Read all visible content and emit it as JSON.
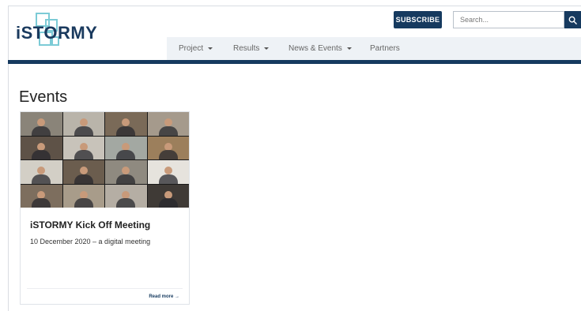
{
  "brand": {
    "name": "iSTORMY"
  },
  "header": {
    "subscribe_label": "SUBSCRIBE",
    "search_placeholder": "Search...",
    "search_value": ""
  },
  "nav": {
    "items": [
      {
        "label": "Project",
        "has_dropdown": true
      },
      {
        "label": "Results",
        "has_dropdown": true
      },
      {
        "label": "News & Events",
        "has_dropdown": true
      },
      {
        "label": "Partners",
        "has_dropdown": false
      }
    ]
  },
  "page": {
    "heading": "Events"
  },
  "events": [
    {
      "title": "iSTORMY Kick Off Meeting",
      "subtitle": "10 December 2020 – a digital meeting",
      "read_more": "Read more →"
    }
  ],
  "colors": {
    "brand_navy": "#163a5f",
    "logo_cyan": "#7ccbd6",
    "nav_bg": "#eef2f6"
  },
  "icons": {
    "search": "search-icon"
  }
}
